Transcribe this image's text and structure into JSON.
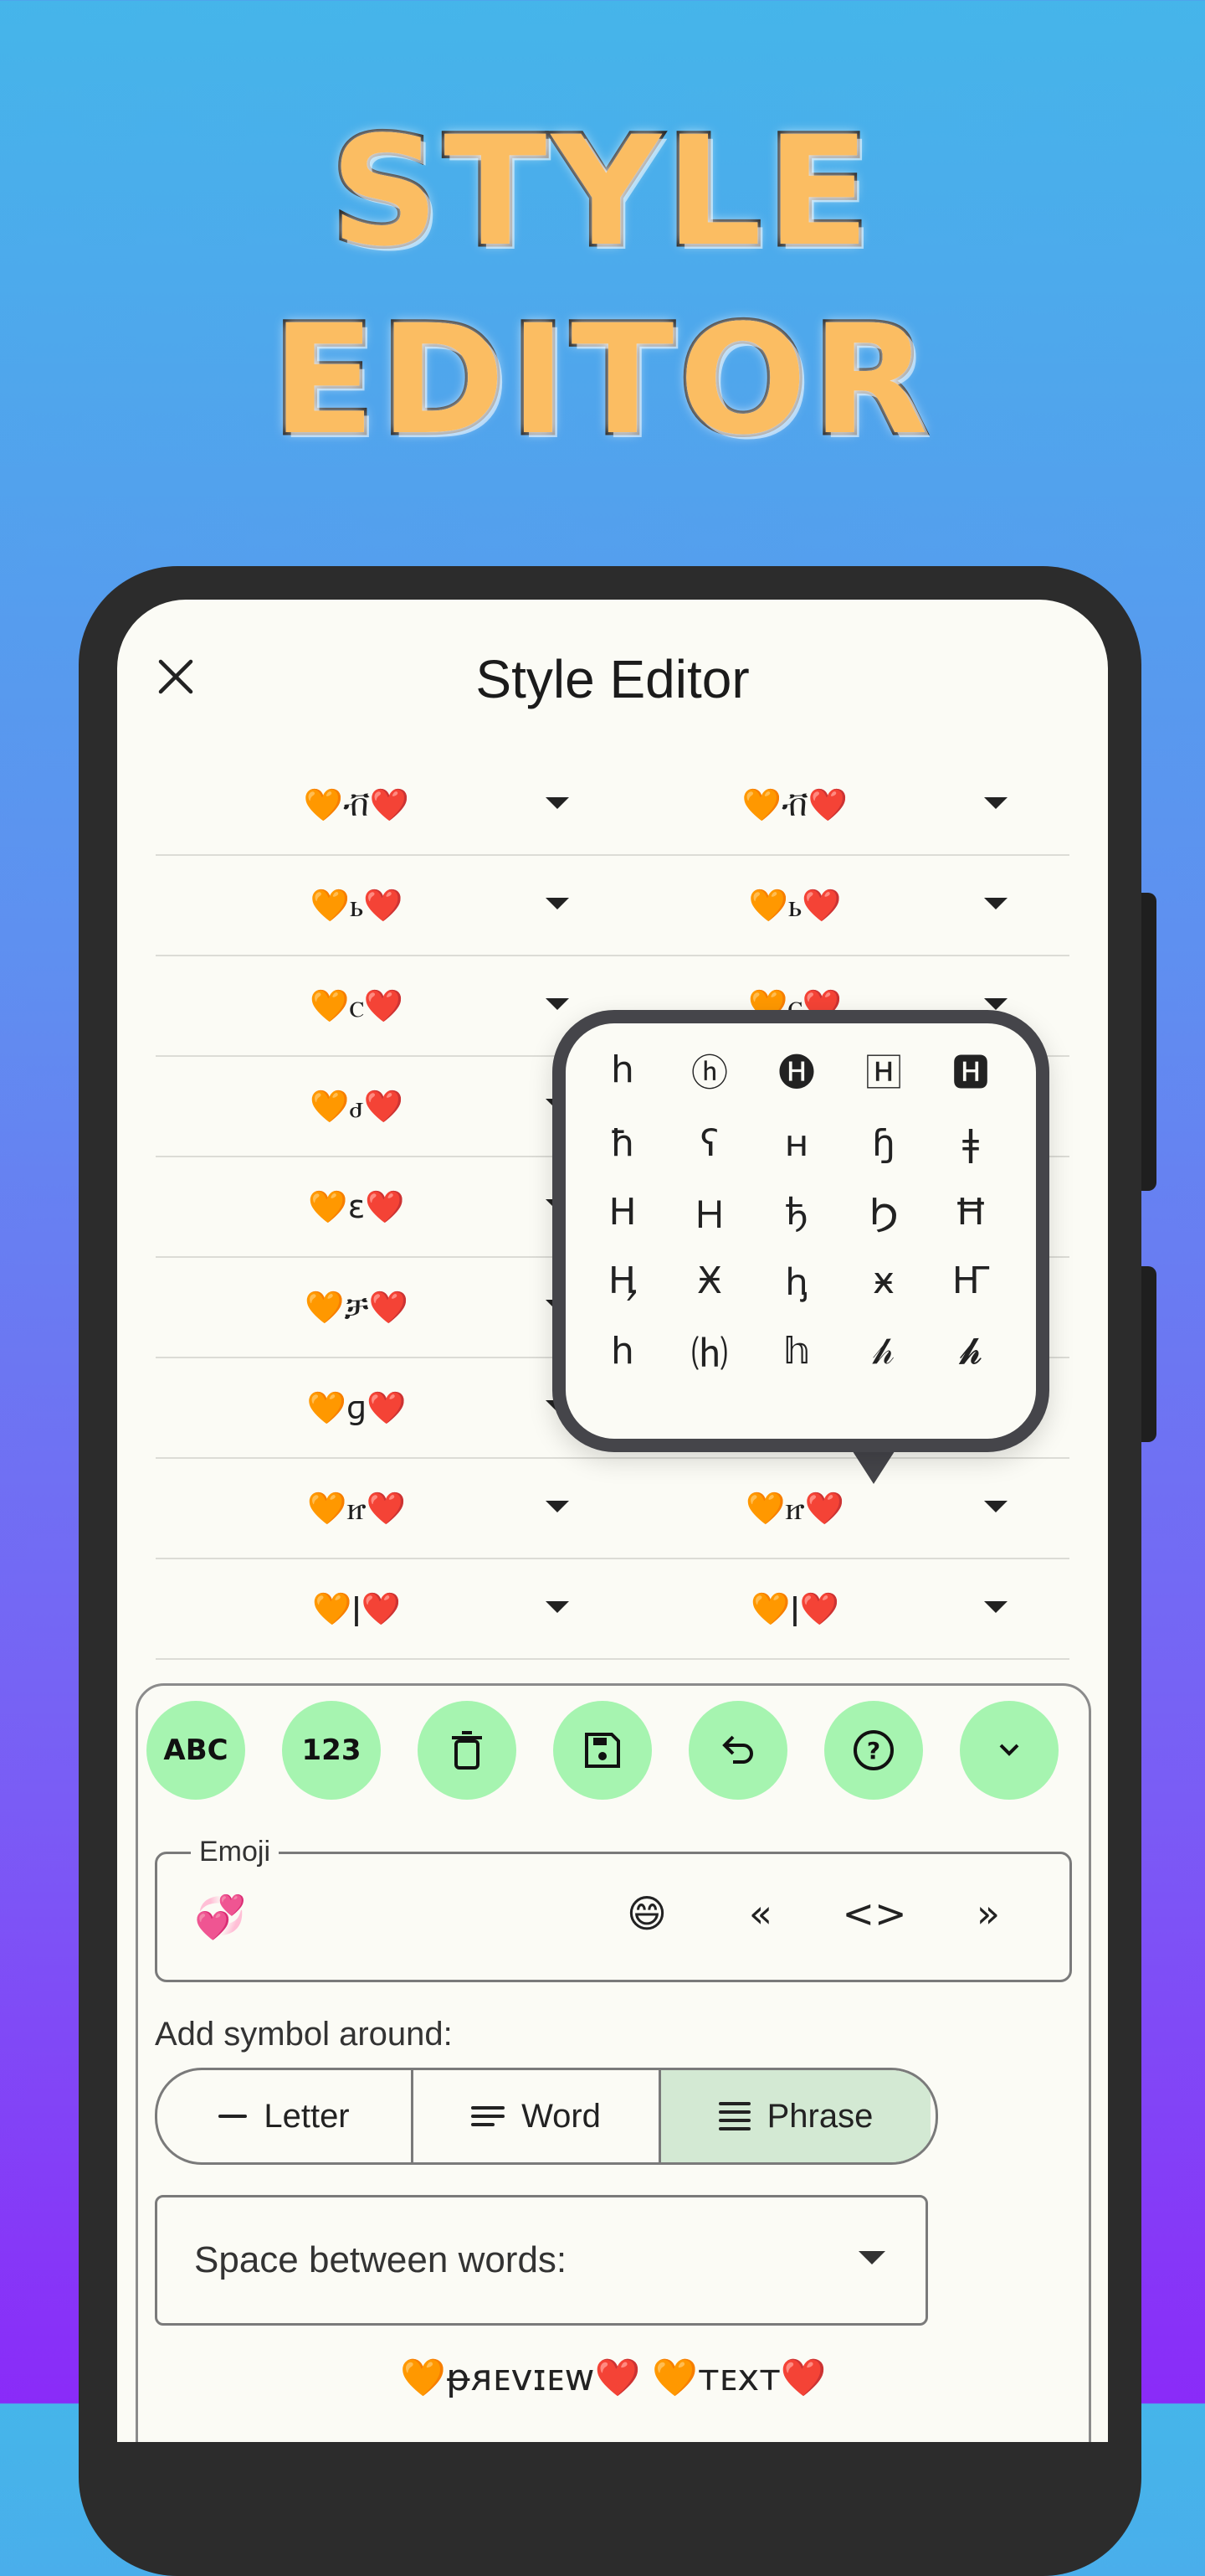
{
  "promo": {
    "line1": "STYLE",
    "line2": "EDITOR"
  },
  "appbar": {
    "title": "Style Editor",
    "close_icon": "close-icon"
  },
  "rows": [
    {
      "left": "🧡ቭ❤️",
      "right": "🧡ቭ❤️"
    },
    {
      "left": "🧡ꮟ❤️",
      "right": "🧡ꮟ❤️"
    },
    {
      "left": "🧡ꮯ❤️",
      "right": "🧡ꮯ❤️"
    },
    {
      "left": "🧡ꮷ❤️",
      "right": ""
    },
    {
      "left": "🧡ɛ❤️",
      "right": ""
    },
    {
      "left": "🧡ቻ❤️",
      "right": ""
    },
    {
      "left": "🧡ɡ❤️",
      "right": ""
    },
    {
      "left": "🧡ꮵ❤️",
      "right": "🧡ꮵ❤️"
    },
    {
      "left": "🧡ǀ❤️",
      "right": "🧡ǀ❤️"
    }
  ],
  "popup": {
    "glyphs": [
      [
        "h",
        "ⓗ",
        "🅗",
        "🄷",
        "🅷"
      ],
      [
        "ħ",
        "ʕ",
        "ʜ",
        "ɧ",
        "ǂ"
      ],
      [
        "Н",
        "Ｈ",
        "ђ",
        "Ϧ",
        "Ħ"
      ],
      [
        "Ӊ",
        "Ӿ",
        "ꞕ",
        "ӿ",
        "Ҥ"
      ],
      [
        "h",
        "⒣",
        "𝕙",
        "𝒽",
        "𝓱"
      ]
    ]
  },
  "toolbar": {
    "buttons": [
      {
        "label": "ABC",
        "icon": "abc-icon"
      },
      {
        "label": "123",
        "icon": "numbers-icon"
      },
      {
        "label": "",
        "icon": "trash-icon"
      },
      {
        "label": "",
        "icon": "save-icon"
      },
      {
        "label": "",
        "icon": "undo-icon"
      },
      {
        "label": "?",
        "icon": "help-icon"
      },
      {
        "label": "⌄",
        "icon": "chevron-down-icon"
      }
    ]
  },
  "emoji_field": {
    "legend": "Emoji",
    "value": "💞",
    "actions": [
      "😄",
      "«",
      "<>",
      "»"
    ]
  },
  "symbol_around": {
    "label": "Add symbol around:",
    "options": [
      "Letter",
      "Word",
      "Phrase"
    ],
    "selected": "Phrase"
  },
  "space_between": {
    "label": "Space between words:"
  },
  "preview": {
    "text": "🧡ᵽᴙᴇᴠɪᴇᴡ❤️ 🧡ᴛᴇxᴛ❤️"
  }
}
